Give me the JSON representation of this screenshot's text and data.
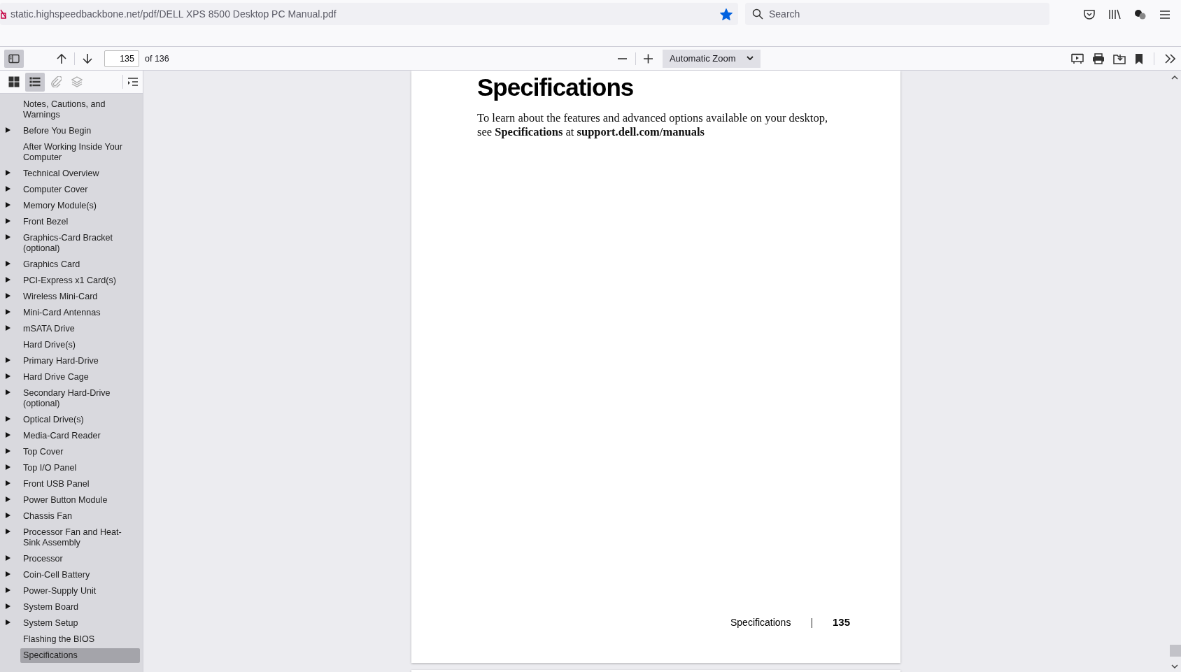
{
  "browser": {
    "url": "static.highspeedbackbone.net/pdf/DELL XPS 8500 Desktop PC Manual.pdf",
    "bookmarked": true,
    "search": {
      "placeholder": "Search"
    }
  },
  "pdf_toolbar": {
    "sidebar_open": true,
    "page_value": "135",
    "page_count": "of 136",
    "zoom": "Automatic Zoom"
  },
  "sidebar": {
    "views": [
      {
        "kind": "thumbnails",
        "selected": false,
        "disabled": false
      },
      {
        "kind": "outline",
        "selected": true,
        "disabled": false
      },
      {
        "kind": "attachments",
        "selected": false,
        "disabled": true
      },
      {
        "kind": "layers",
        "selected": false,
        "disabled": true
      }
    ],
    "outline": [
      {
        "label": "Notes, Cautions, and Warnings",
        "expandable": false,
        "selected": false
      },
      {
        "label": "Before You Begin",
        "expandable": true,
        "selected": false
      },
      {
        "label": "After Working Inside Your Computer",
        "expandable": false,
        "selected": false
      },
      {
        "label": "Technical Overview",
        "expandable": true,
        "selected": false
      },
      {
        "label": "Computer Cover",
        "expandable": true,
        "selected": false
      },
      {
        "label": "Memory Module(s)",
        "expandable": true,
        "selected": false
      },
      {
        "label": "Front Bezel",
        "expandable": true,
        "selected": false
      },
      {
        "label": "Graphics-Card Bracket (optional)",
        "expandable": true,
        "selected": false
      },
      {
        "label": "Graphics Card",
        "expandable": true,
        "selected": false
      },
      {
        "label": "PCI-Express x1 Card(s)",
        "expandable": true,
        "selected": false
      },
      {
        "label": "Wireless Mini-Card",
        "expandable": true,
        "selected": false
      },
      {
        "label": "Mini-Card Antennas",
        "expandable": true,
        "selected": false
      },
      {
        "label": "mSATA Drive",
        "expandable": true,
        "selected": false
      },
      {
        "label": "Hard Drive(s)",
        "expandable": false,
        "selected": false
      },
      {
        "label": "Primary Hard-Drive",
        "expandable": true,
        "selected": false
      },
      {
        "label": "Hard Drive Cage",
        "expandable": true,
        "selected": false
      },
      {
        "label": "Secondary Hard-Drive (optional)",
        "expandable": true,
        "selected": false
      },
      {
        "label": "Optical Drive(s)",
        "expandable": true,
        "selected": false
      },
      {
        "label": "Media-Card Reader",
        "expandable": true,
        "selected": false
      },
      {
        "label": "Top Cover",
        "expandable": true,
        "selected": false
      },
      {
        "label": "Top I/O Panel",
        "expandable": true,
        "selected": false
      },
      {
        "label": "Front USB Panel",
        "expandable": true,
        "selected": false
      },
      {
        "label": "Power Button Module",
        "expandable": true,
        "selected": false
      },
      {
        "label": "Chassis Fan",
        "expandable": true,
        "selected": false
      },
      {
        "label": "Processor Fan and Heat-Sink Assembly",
        "expandable": true,
        "selected": false
      },
      {
        "label": "Processor",
        "expandable": true,
        "selected": false
      },
      {
        "label": "Coin-Cell Battery",
        "expandable": true,
        "selected": false
      },
      {
        "label": "Power-Supply Unit",
        "expandable": true,
        "selected": false
      },
      {
        "label": "System Board",
        "expandable": true,
        "selected": false
      },
      {
        "label": "System Setup",
        "expandable": true,
        "selected": false
      },
      {
        "label": "Flashing the BIOS",
        "expandable": false,
        "selected": false
      },
      {
        "label": "Specifications",
        "expandable": false,
        "selected": true
      }
    ]
  },
  "page": {
    "heading": "Specifications",
    "body": "To learn about the features and advanced options available on your desktop, see **Specifications** at **support.dell.com/manuals**",
    "footer_title": "Specifications",
    "footer_separator": "|",
    "footer_number": "135"
  }
}
